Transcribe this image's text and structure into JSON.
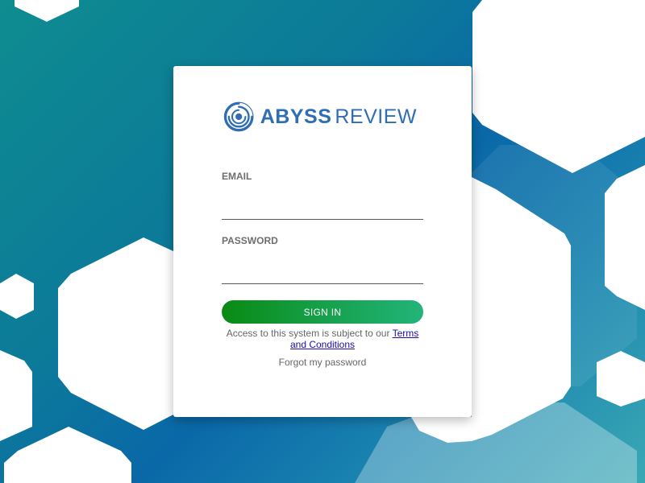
{
  "brand": {
    "name_bold": "ABYSS",
    "name_light": "REVIEW",
    "color": "#2f6eb4"
  },
  "form": {
    "email_label": "EMAIL",
    "email_value": "",
    "password_label": "PASSWORD",
    "password_value": "",
    "sign_in_label": "SIGN IN",
    "terms_prefix": "Access to this system is subject to our ",
    "terms_link": "Terms and Conditions",
    "forgot_label": "Forgot my password"
  },
  "colors": {
    "button_start": "#0a8a14",
    "button_end": "#22b47a",
    "link": "#1a0dab"
  }
}
